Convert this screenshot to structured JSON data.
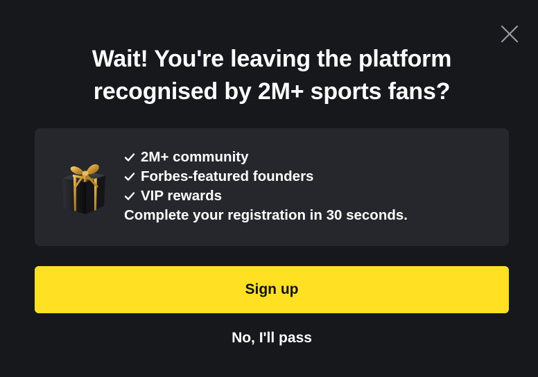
{
  "modal": {
    "title_line1": "Wait! You're leaving the platform",
    "title_line2": "recognised by 2M+ sports fans?",
    "close_icon": "close-icon"
  },
  "promo": {
    "image_icon": "gift-box-icon",
    "benefits": [
      {
        "icon": "check-icon",
        "label": "2M+ community"
      },
      {
        "icon": "check-icon",
        "label": "Forbes-featured founders"
      },
      {
        "icon": "check-icon",
        "label": "VIP rewards"
      }
    ],
    "note": "Complete your registration in 30 seconds."
  },
  "actions": {
    "signup_label": "Sign up",
    "pass_label": "No, I'll pass"
  },
  "colors": {
    "background": "#17181c",
    "card": "#26272c",
    "accent": "#ffe022",
    "text": "#ffffff"
  }
}
